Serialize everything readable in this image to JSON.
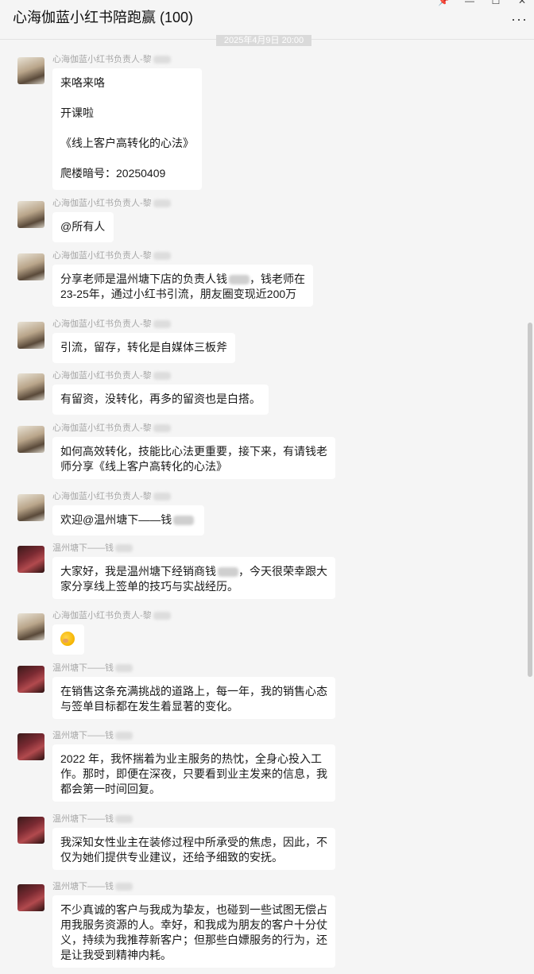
{
  "window": {
    "title": "心海伽蓝小红书陪跑赢 (100)",
    "pin_icon": "pin-icon",
    "minimize_icon": "minimize-icon",
    "maximize_icon": "maximize-icon",
    "close_icon": "close-icon",
    "more_label": "···"
  },
  "timestamp": "2025年4月9日 20:00",
  "senders": {
    "host": "心海伽蓝小红书负责人-黎",
    "guest": "温州塘下——钱"
  },
  "messages": [
    {
      "sender": "心海伽蓝小红书负责人-黎",
      "lines": [
        "来咯来咯",
        "",
        "开课啦",
        "",
        "《线上客户高转化的心法》",
        "",
        "爬楼暗号：20250409"
      ]
    },
    {
      "sender": "心海伽蓝小红书负责人-黎",
      "lines": [
        "@所有人"
      ]
    },
    {
      "sender": "心海伽蓝小红书负责人-黎",
      "lines": [
        "分享老师是温州塘下店的负责人钱",
        "，钱老师在",
        "23-25年，通过小红书引流，朋友圈变现近200万"
      ]
    },
    {
      "sender": "心海伽蓝小红书负责人-黎",
      "lines": [
        "引流，留存，转化是自媒体三板斧"
      ]
    },
    {
      "sender": "心海伽蓝小红书负责人-黎",
      "lines": [
        "有留资，没转化，再多的留资也是白搭。"
      ]
    },
    {
      "sender": "心海伽蓝小红书负责人-黎",
      "lines": [
        "如何高效转化，技能比心法更重要，接下来，有请钱老",
        "师分享《线上客户高转化的心法》"
      ]
    },
    {
      "sender": "心海伽蓝小红书负责人-黎",
      "lines": [
        "欢迎@温州塘下——钱"
      ]
    },
    {
      "sender": "温州塘下——钱",
      "lines": [
        "大家好，我是温州塘下经销商钱",
        "，今天很荣幸跟大",
        "家分享线上签单的技巧与实战经历。"
      ]
    },
    {
      "sender": "心海伽蓝小红书负责人-黎",
      "emoji": "smile-emoji-icon"
    },
    {
      "sender": "温州塘下——钱",
      "lines": [
        "在销售这条充满挑战的道路上，每一年，我的销售心态",
        "与签单目标都在发生着显著的变化。"
      ]
    },
    {
      "sender": "温州塘下——钱",
      "lines": [
        "2022 年，我怀揣着为业主服务的热忱，全身心投入工",
        "作。那时，即便在深夜，只要看到业主发来的信息，我",
        "都会第一时间回复。"
      ]
    },
    {
      "sender": "温州塘下——钱",
      "lines": [
        "我深知女性业主在装修过程中所承受的焦虑，因此，不",
        "仅为她们提供专业建议，还给予细致的安抚。"
      ]
    },
    {
      "sender": "温州塘下——钱",
      "lines": [
        "不少真诚的客户与我成为挚友，也碰到一些试图无偿占",
        "用我服务资源的人。幸好，和我成为朋友的客户十分仗",
        "义，持续为我推荐新客户；但那些白嫖服务的行为，还",
        "是让我受到精神内耗。"
      ]
    }
  ]
}
